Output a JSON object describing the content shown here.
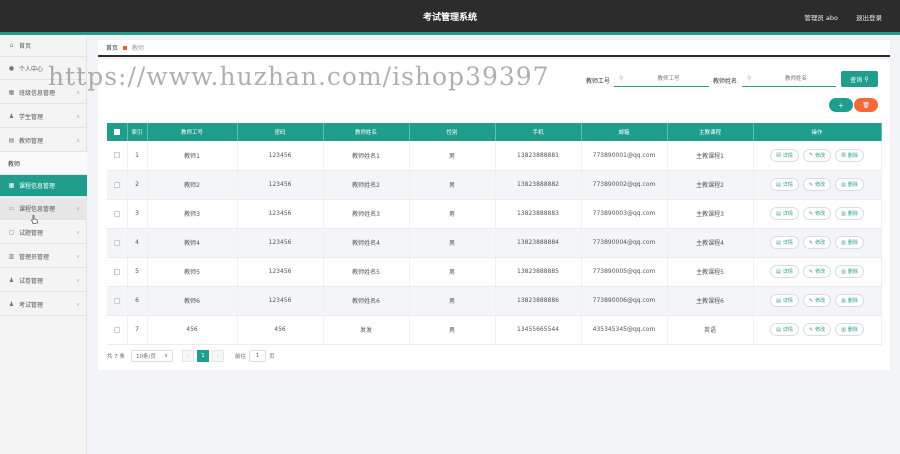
{
  "header": {
    "title": "考试管理系统",
    "user": "管理员 abo",
    "logout": "退出登录"
  },
  "sidebar": {
    "items": [
      {
        "label": "首页",
        "icon": "home-icon"
      },
      {
        "label": "个人中心",
        "icon": "user-icon"
      },
      {
        "label": "班级信息管理",
        "icon": "grid-icon"
      },
      {
        "label": "学生管理",
        "icon": "person-icon"
      },
      {
        "label": "教师管理",
        "icon": "list-icon"
      },
      {
        "label": "教师",
        "icon": ""
      },
      {
        "label": "课程信息管理",
        "icon": "grid-icon"
      },
      {
        "label": "课程信息管理",
        "icon": "book-icon"
      },
      {
        "label": "试题管理",
        "icon": "doc-icon"
      },
      {
        "label": "管理员管理",
        "icon": "chart-icon"
      },
      {
        "label": "试卷管理",
        "icon": "person-icon"
      },
      {
        "label": "考试管理",
        "icon": "person-icon"
      }
    ]
  },
  "breadcrumb": {
    "home": "首页",
    "current": "教师"
  },
  "search": {
    "id_label": "教师工号",
    "id_placeholder": "教师工号",
    "name_label": "教师姓名",
    "name_placeholder": "教师姓名",
    "query_label": "查询"
  },
  "actions": {
    "add": "+",
    "delete": "🗑"
  },
  "table": {
    "headers": [
      "",
      "索引",
      "教师工号",
      "密码",
      "教师姓名",
      "性别",
      "手机",
      "邮箱",
      "主教课程",
      "操作"
    ],
    "rows": [
      {
        "index": "1",
        "id": "教师1",
        "password": "123456",
        "name": "教师姓名1",
        "gender": "男",
        "phone": "13823888881",
        "email": "773890001@qq.com",
        "course": "主教课程1"
      },
      {
        "index": "2",
        "id": "教师2",
        "password": "123456",
        "name": "教师姓名2",
        "gender": "男",
        "phone": "13823888882",
        "email": "773890002@qq.com",
        "course": "主教课程2"
      },
      {
        "index": "3",
        "id": "教师3",
        "password": "123456",
        "name": "教师姓名3",
        "gender": "男",
        "phone": "13823888883",
        "email": "773890003@qq.com",
        "course": "主教课程3"
      },
      {
        "index": "4",
        "id": "教师4",
        "password": "123456",
        "name": "教师姓名4",
        "gender": "男",
        "phone": "13823888884",
        "email": "773890004@qq.com",
        "course": "主教课程4"
      },
      {
        "index": "5",
        "id": "教师5",
        "password": "123456",
        "name": "教师姓名5",
        "gender": "男",
        "phone": "13823888885",
        "email": "773890005@qq.com",
        "course": "主教课程5"
      },
      {
        "index": "6",
        "id": "教师6",
        "password": "123456",
        "name": "教师姓名6",
        "gender": "男",
        "phone": "13823888886",
        "email": "773890006@qq.com",
        "course": "主教课程6"
      },
      {
        "index": "7",
        "id": "456",
        "password": "456",
        "name": "发发",
        "gender": "男",
        "phone": "13455665544",
        "email": "435345345@qq.com",
        "course": "英语"
      }
    ],
    "ops": {
      "detail": "详情",
      "edit": "修改",
      "delete": "删除"
    }
  },
  "pager": {
    "total": "共 7 条",
    "page_size": "10条/页",
    "current_page": "1",
    "goto_label": "前往",
    "goto_value": "1",
    "page_unit": "页"
  },
  "watermark": "https://www.huzhan.com/ishop39397",
  "colors": {
    "accent": "#1f9e8d",
    "danger": "#f4683a",
    "topbar": "#2c2c2c"
  }
}
